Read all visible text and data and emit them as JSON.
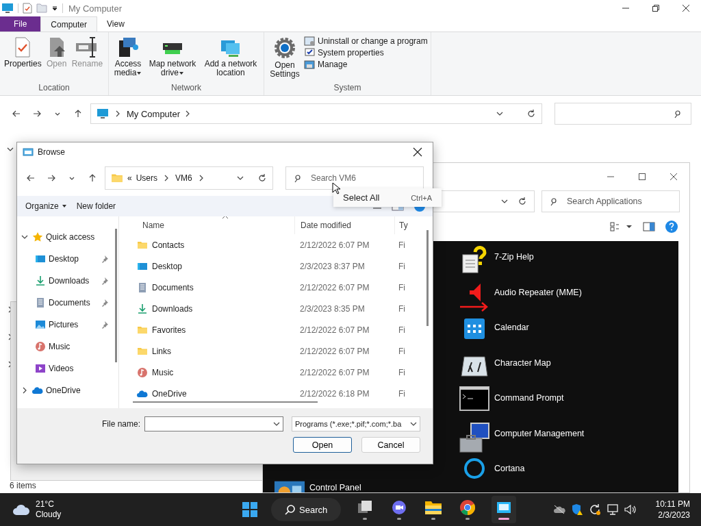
{
  "explorer": {
    "title": "My Computer",
    "tabs": [
      {
        "label": "File",
        "kind": "file",
        "selected": false
      },
      {
        "label": "Computer",
        "kind": "tab",
        "selected": true
      },
      {
        "label": "View",
        "kind": "tab",
        "selected": false
      }
    ],
    "groups": [
      {
        "label": "Location",
        "buttons": [
          {
            "label": "Properties",
            "kind": "properties",
            "disabled": false,
            "dropdown": false
          },
          {
            "label": "Open",
            "kind": "open",
            "disabled": true,
            "dropdown": false
          },
          {
            "label": "Rename",
            "kind": "rename",
            "disabled": true,
            "dropdown": false
          }
        ]
      },
      {
        "label": "Network",
        "buttons": [
          {
            "label": "Access media",
            "kind": "media",
            "disabled": false,
            "dropdown": true
          },
          {
            "label": "Map network drive",
            "kind": "drive",
            "disabled": false,
            "dropdown": true
          },
          {
            "label": "Add a network location",
            "kind": "netloc",
            "disabled": false,
            "dropdown": false
          }
        ]
      },
      {
        "label": "System",
        "buttons": [
          {
            "label": "Open Settings",
            "kind": "settings",
            "disabled": false,
            "dropdown": false
          }
        ],
        "small_buttons": [
          {
            "label": "Uninstall or change a program",
            "kind": "uninstall"
          },
          {
            "label": "System properties",
            "kind": "sysprops"
          },
          {
            "label": "Manage",
            "kind": "manage"
          }
        ]
      }
    ],
    "breadcrumb": [
      "My Computer"
    ],
    "status": "6 items"
  },
  "apps_window": {
    "search": {
      "placeholder": "Search Applications"
    },
    "left_column": [
      {
        "name": "Control Panel",
        "kind": "control"
      }
    ],
    "right_column": [
      {
        "name": "7-Zip Help",
        "kind": "help"
      },
      {
        "name": "Audio Repeater (MME)",
        "kind": "audio"
      },
      {
        "name": "Calendar",
        "kind": "calendar"
      },
      {
        "name": "Character Map",
        "kind": "charmap"
      },
      {
        "name": "Command Prompt",
        "kind": "cmd"
      },
      {
        "name": "Computer Management",
        "kind": "mgmt"
      },
      {
        "name": "Cortana",
        "kind": "cortana"
      }
    ]
  },
  "browse": {
    "title": "Browse",
    "path": [
      "«",
      "Users",
      "VM6"
    ],
    "search": {
      "placeholder": "Search VM6"
    },
    "toolbar": [
      "Organize",
      "New folder"
    ],
    "nav": [
      {
        "label": "Quick access",
        "kind": "star",
        "expanded": true,
        "children": [
          {
            "label": "Desktop",
            "kind": "desktop",
            "pinned": true
          },
          {
            "label": "Downloads",
            "kind": "download",
            "pinned": true
          },
          {
            "label": "Documents",
            "kind": "document",
            "pinned": true
          },
          {
            "label": "Pictures",
            "kind": "pictures",
            "pinned": true
          },
          {
            "label": "Music",
            "kind": "music",
            "pinned": false
          },
          {
            "label": "Videos",
            "kind": "videos",
            "pinned": false
          }
        ]
      },
      {
        "label": "OneDrive",
        "kind": "cloud",
        "expanded": false
      }
    ],
    "columns": [
      "Name",
      "Date modified",
      "Ty"
    ],
    "files": [
      {
        "name": "Contacts",
        "kind": "folder",
        "date": "2/12/2022 6:07 PM",
        "type": "Fi"
      },
      {
        "name": "Desktop",
        "kind": "desktop",
        "date": "2/3/2023 8:37 PM",
        "type": "Fi"
      },
      {
        "name": "Documents",
        "kind": "document",
        "date": "2/12/2022 6:07 PM",
        "type": "Fi"
      },
      {
        "name": "Downloads",
        "kind": "download",
        "date": "2/3/2023 8:35 PM",
        "type": "Fi"
      },
      {
        "name": "Favorites",
        "kind": "folder",
        "date": "2/12/2022 6:07 PM",
        "type": "Fi"
      },
      {
        "name": "Links",
        "kind": "folder",
        "date": "2/12/2022 6:07 PM",
        "type": "Fi"
      },
      {
        "name": "Music",
        "kind": "music",
        "date": "2/12/2022 6:07 PM",
        "type": "Fi"
      },
      {
        "name": "OneDrive",
        "kind": "cloud",
        "date": "2/12/2022 6:18 PM",
        "type": "Fi"
      }
    ],
    "file_name_label": "File name:",
    "file_type": "Programs (*.exe;*.pif;*.com;*.ba",
    "buttons": [
      {
        "label": "Open",
        "default": true
      },
      {
        "label": "Cancel",
        "default": false
      }
    ]
  },
  "context_menu": [
    {
      "label": "Select All",
      "shortcut": "Ctrl+A"
    }
  ],
  "taskbar": {
    "weather": {
      "temp": "21°C",
      "condition": "Cloudy"
    },
    "search": "Search",
    "apps": [
      {
        "kind": "taskview",
        "active": false
      },
      {
        "kind": "chat",
        "active": false
      },
      {
        "kind": "explorer",
        "active": false
      },
      {
        "kind": "chrome",
        "active": false
      },
      {
        "kind": "app",
        "active": true
      }
    ],
    "time": "10:11 PM",
    "date": "2/3/2023"
  }
}
